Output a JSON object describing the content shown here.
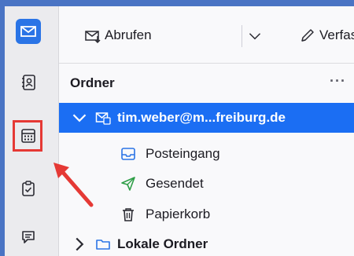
{
  "spaces": {
    "items": [
      {
        "name": "mail-icon",
        "active": true
      },
      {
        "name": "address-book-icon",
        "active": false
      },
      {
        "name": "calendar-icon",
        "active": false,
        "highlighted": true
      },
      {
        "name": "tasks-icon",
        "active": false
      },
      {
        "name": "chat-icon",
        "active": false
      }
    ]
  },
  "toolbar": {
    "get_messages_label": "Abrufen",
    "compose_label": "Verfassen"
  },
  "folder_pane": {
    "header": "Ordner",
    "menu_label": "···",
    "account": "tim.weber@m...freiburg.de",
    "folders": [
      "Posteingang",
      "Gesendet",
      "Papierkorb"
    ],
    "local_folders": "Lokale Ordner"
  },
  "colors": {
    "accent": "#1b6ef3",
    "annotation": "#e53935",
    "background": "#4a74c4"
  }
}
